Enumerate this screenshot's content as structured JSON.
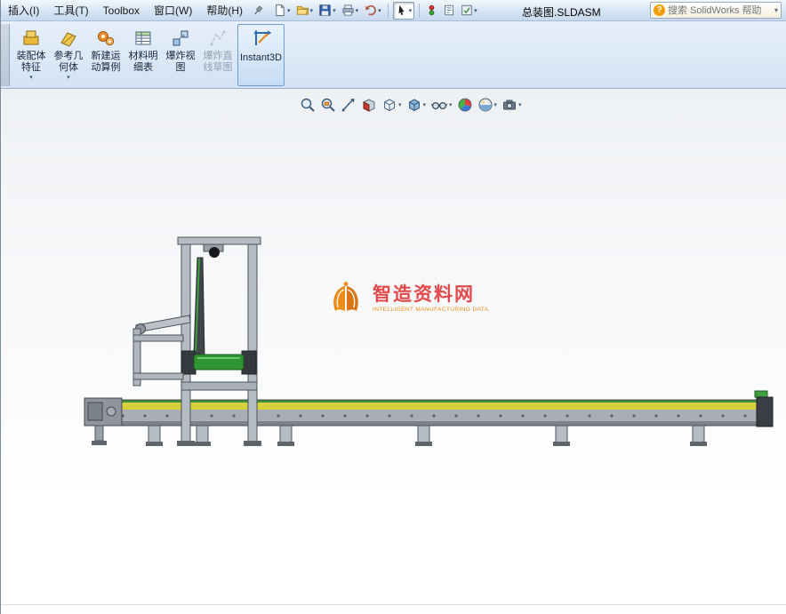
{
  "menubar": {
    "items": [
      {
        "label": "插入(I)"
      },
      {
        "label": "工具(T)"
      },
      {
        "label": "Toolbox"
      },
      {
        "label": "窗口(W)"
      },
      {
        "label": "帮助(H)"
      }
    ],
    "document_title": "总装图.SLDASM",
    "search_placeholder": "搜索 SolidWorks 帮助"
  },
  "quick_toolbar": {
    "buttons": [
      "new-document",
      "open",
      "save",
      "print",
      "undo",
      "select",
      "rebuild",
      "file-properties",
      "options"
    ]
  },
  "command_manager": {
    "buttons": [
      {
        "label": "装配体特征",
        "enabled": true,
        "active": false,
        "has_dropdown": true
      },
      {
        "label": "参考几何体",
        "enabled": true,
        "active": false,
        "has_dropdown": true
      },
      {
        "label": "新建运动算例",
        "enabled": true,
        "active": false,
        "has_dropdown": false
      },
      {
        "label": "材料明细表",
        "enabled": true,
        "active": false,
        "has_dropdown": false
      },
      {
        "label": "爆炸视图",
        "enabled": true,
        "active": false,
        "has_dropdown": false
      },
      {
        "label": "爆炸直线草图",
        "enabled": false,
        "active": false,
        "has_dropdown": false
      },
      {
        "label": "Instant3D",
        "enabled": true,
        "active": true,
        "has_dropdown": false
      }
    ]
  },
  "heads_up_toolbar": {
    "icons": [
      "zoom-fit",
      "zoom-to-area",
      "zoom-in-out",
      "section-view",
      "view-orientation",
      "display-style",
      "hide-show-items",
      "edit-appearance",
      "apply-scene",
      "view-settings"
    ]
  },
  "viewport": {
    "watermark": {
      "title": "智造资料网",
      "subtitle": "INTELLIGENT MANUFACTURING DATA"
    }
  },
  "colors": {
    "watermark_title": "#e23b3b",
    "watermark_accent": "#ef8200",
    "instant3d_highlight": "#cfe3f8",
    "belt_green": "#2f9433",
    "conveyor_yellow": "#d8cf3d"
  }
}
